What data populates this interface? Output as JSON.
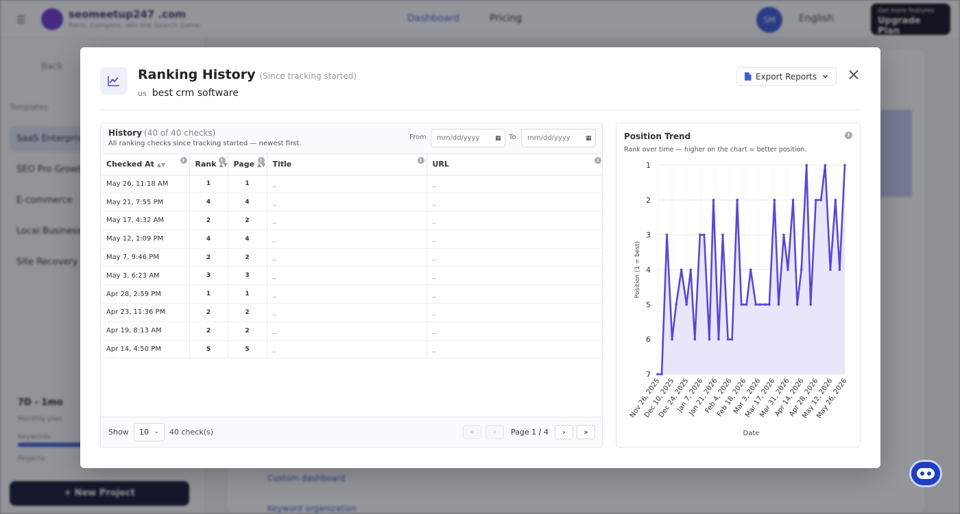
{
  "background": {
    "brand": "seomeetup247 .com",
    "brand_sub": "Rank. Compete. Win the Search Game",
    "nav_dashboard": "Dashboard",
    "nav_pricing": "Pricing",
    "avatar_initials": "SM",
    "language": "English",
    "upgrade_small": "Get more features",
    "upgrade_big": "Upgrade Plan",
    "breadcrumb": "Back",
    "sidebar_section": "Templates",
    "sidebar_items": [
      "SaaS Enterprise",
      "SEO Pro Growth",
      "E-commerce",
      "Local Business",
      "Site Recovery"
    ],
    "usage_title": "7D - 1mo",
    "usage_sub": "Monthly plan",
    "usage_label_a": "Keywords",
    "usage_label_b": "Projects",
    "new_project": "+ New Project",
    "table_rows": [
      "Custom dashboard",
      "Keyword organization"
    ]
  },
  "modal": {
    "title": "Ranking History",
    "title_note": "(Since tracking started)",
    "country_code": "us",
    "keyword": "best crm software",
    "export_label": "Export Reports",
    "close_label": "✕",
    "icon": "line-chart-icon"
  },
  "history": {
    "title": "History",
    "count_label": "(40 of 40 checks)",
    "description": "All ranking checks since tracking started — newest first.",
    "from_label": "From",
    "to_label": "To",
    "from_placeholder": "mm/dd/yyyy",
    "to_placeholder": "mm/dd/yyyy",
    "columns": [
      "Checked At",
      "Rank",
      "Page",
      "Title",
      "URL"
    ],
    "rows": [
      {
        "checked_at": "May 26, 11:18 AM",
        "rank": "1",
        "page": "1",
        "title": "_",
        "url": "_"
      },
      {
        "checked_at": "May 21, 7:55 PM",
        "rank": "4",
        "page": "4",
        "title": "_",
        "url": "_"
      },
      {
        "checked_at": "May 17, 4:32 AM",
        "rank": "2",
        "page": "2",
        "title": "_",
        "url": "_"
      },
      {
        "checked_at": "May 12, 1:09 PM",
        "rank": "4",
        "page": "4",
        "title": "_",
        "url": "_"
      },
      {
        "checked_at": "May 7, 9:46 PM",
        "rank": "2",
        "page": "2",
        "title": "_",
        "url": "_"
      },
      {
        "checked_at": "May 3, 6:23 AM",
        "rank": "3",
        "page": "3",
        "title": "_",
        "url": "_"
      },
      {
        "checked_at": "Apr 28, 2:59 PM",
        "rank": "1",
        "page": "1",
        "title": "_",
        "url": "_"
      },
      {
        "checked_at": "Apr 23, 11:36 PM",
        "rank": "2",
        "page": "2",
        "title": "_",
        "url": "_"
      },
      {
        "checked_at": "Apr 19, 8:13 AM",
        "rank": "2",
        "page": "2",
        "title": "_",
        "url": "_"
      },
      {
        "checked_at": "Apr 14, 4:50 PM",
        "rank": "5",
        "page": "5",
        "title": "_",
        "url": "_"
      }
    ],
    "show_label": "Show",
    "page_size": "10",
    "total_label": "40 check(s)",
    "page_label": "Page 1 / 4",
    "pagination": {
      "first": "«",
      "prev": "‹",
      "next": "›",
      "last": "»"
    }
  },
  "colors": {
    "line": "#5a46d6",
    "fill": "#e6e3fb",
    "accent": "#3b5bdb"
  },
  "chart_data": {
    "type": "area",
    "title": "Position Trend",
    "subtitle": "Rank over time — higher on the chart = better position.",
    "xlabel": "Date",
    "ylabel": "Position (1 = best)",
    "y_inverted": true,
    "ylim": [
      1,
      7
    ],
    "yticks": [
      1,
      2,
      3,
      4,
      5,
      6,
      7
    ],
    "grid": true,
    "x_tick_labels": [
      "Nov 26, 2025",
      "Dec 10, 2025",
      "Dec 24, 2025",
      "Jan 7, 2026",
      "Jan 21, 2026",
      "Feb 4, 2026",
      "Feb 18, 2026",
      "Mar 3, 2026",
      "Mar 17, 2026",
      "Mar 31, 2026",
      "Apr 14, 2026",
      "Apr 28, 2026",
      "May 12, 2026",
      "May 26, 2026"
    ],
    "x": [
      "2025-11-26",
      "2025-11-30",
      "2025-12-05",
      "2025-12-10",
      "2025-12-14",
      "2025-12-19",
      "2025-12-24",
      "2025-12-28",
      "2026-01-01",
      "2026-01-06",
      "2026-01-10",
      "2026-01-15",
      "2026-01-19",
      "2026-01-24",
      "2026-01-28",
      "2026-02-02",
      "2026-02-06",
      "2026-02-11",
      "2026-02-15",
      "2026-02-20",
      "2026-02-24",
      "2026-03-01",
      "2026-03-05",
      "2026-03-10",
      "2026-03-14",
      "2026-03-19",
      "2026-03-23",
      "2026-03-28",
      "2026-04-01",
      "2026-04-06",
      "2026-04-10",
      "2026-04-14",
      "2026-04-19",
      "2026-04-23",
      "2026-04-28",
      "2026-05-03",
      "2026-05-07",
      "2026-05-12",
      "2026-05-17",
      "2026-05-21",
      "2026-05-26"
    ],
    "series": [
      {
        "values": [
          7,
          7,
          3,
          6,
          5,
          4,
          5,
          4,
          6,
          3,
          3,
          6,
          2,
          6,
          3,
          6,
          6,
          2,
          5,
          5,
          4,
          5,
          5,
          5,
          5,
          2,
          5,
          3,
          4,
          2,
          5,
          4,
          1,
          5,
          2,
          2,
          1,
          4,
          2,
          4,
          1
        ]
      }
    ]
  }
}
